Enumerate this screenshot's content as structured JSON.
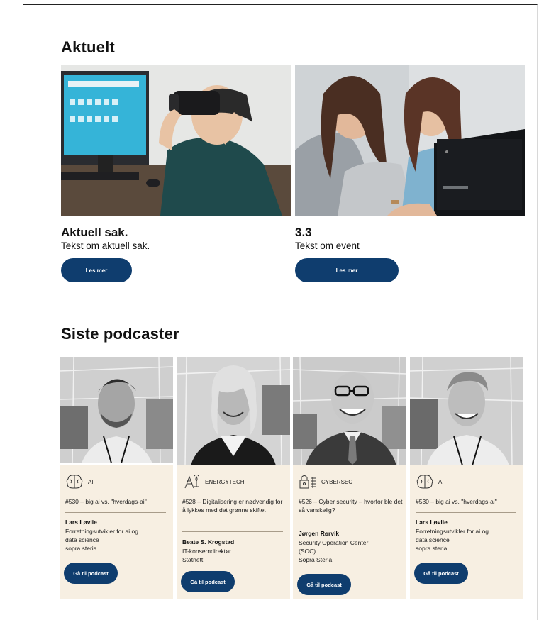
{
  "sections": {
    "news_heading": "Aktuelt",
    "podcasts_heading": "Siste podcaster"
  },
  "news": [
    {
      "title": "Aktuell sak.",
      "text": "Tekst om aktuell sak.",
      "button": "Les mer",
      "image": "vr-headset-photo"
    },
    {
      "title": "3.3",
      "text": "Tekst om event",
      "button": "Les mer",
      "image": "laptop-group-photo"
    }
  ],
  "podcasts": [
    {
      "category": "AI",
      "icon": "brain-icon",
      "title": "#530 – big ai vs. \"hverdags-ai\"",
      "name": "Lars Løvlie",
      "role": "Forretningsutvikler for ai og\ndata science\nsopra steria",
      "button": "Gå til podcast"
    },
    {
      "category": "ENERGYTECH",
      "icon": "energy-icon",
      "title": "#528 – Digitalisering er nødvendig for å lykkes med det grønne skiftet",
      "name": "Beate S. Krogstad",
      "role": "IT-konserndirektør\nStatnett",
      "button": "Gå til podcast"
    },
    {
      "category": "CYBERSEC",
      "icon": "lock-icon",
      "title": "#526 – Cyber security – hvorfor ble det så vanskelig?",
      "name": "Jørgen Rørvik",
      "role": "Security Operation Center\n(SOC)\nSopra Steria",
      "button": "Gå til podcast"
    },
    {
      "category": "AI",
      "icon": "brain-icon",
      "title": "#530 – big ai vs. \"hverdags-ai\"",
      "name": "Lars Løvlie",
      "role": "Forretningsutvikler for ai og\ndata science\nsopra steria",
      "button": "Gå til podcast"
    }
  ],
  "colors": {
    "button": "#0f3d6e",
    "card_bg": "#f7efe2"
  }
}
